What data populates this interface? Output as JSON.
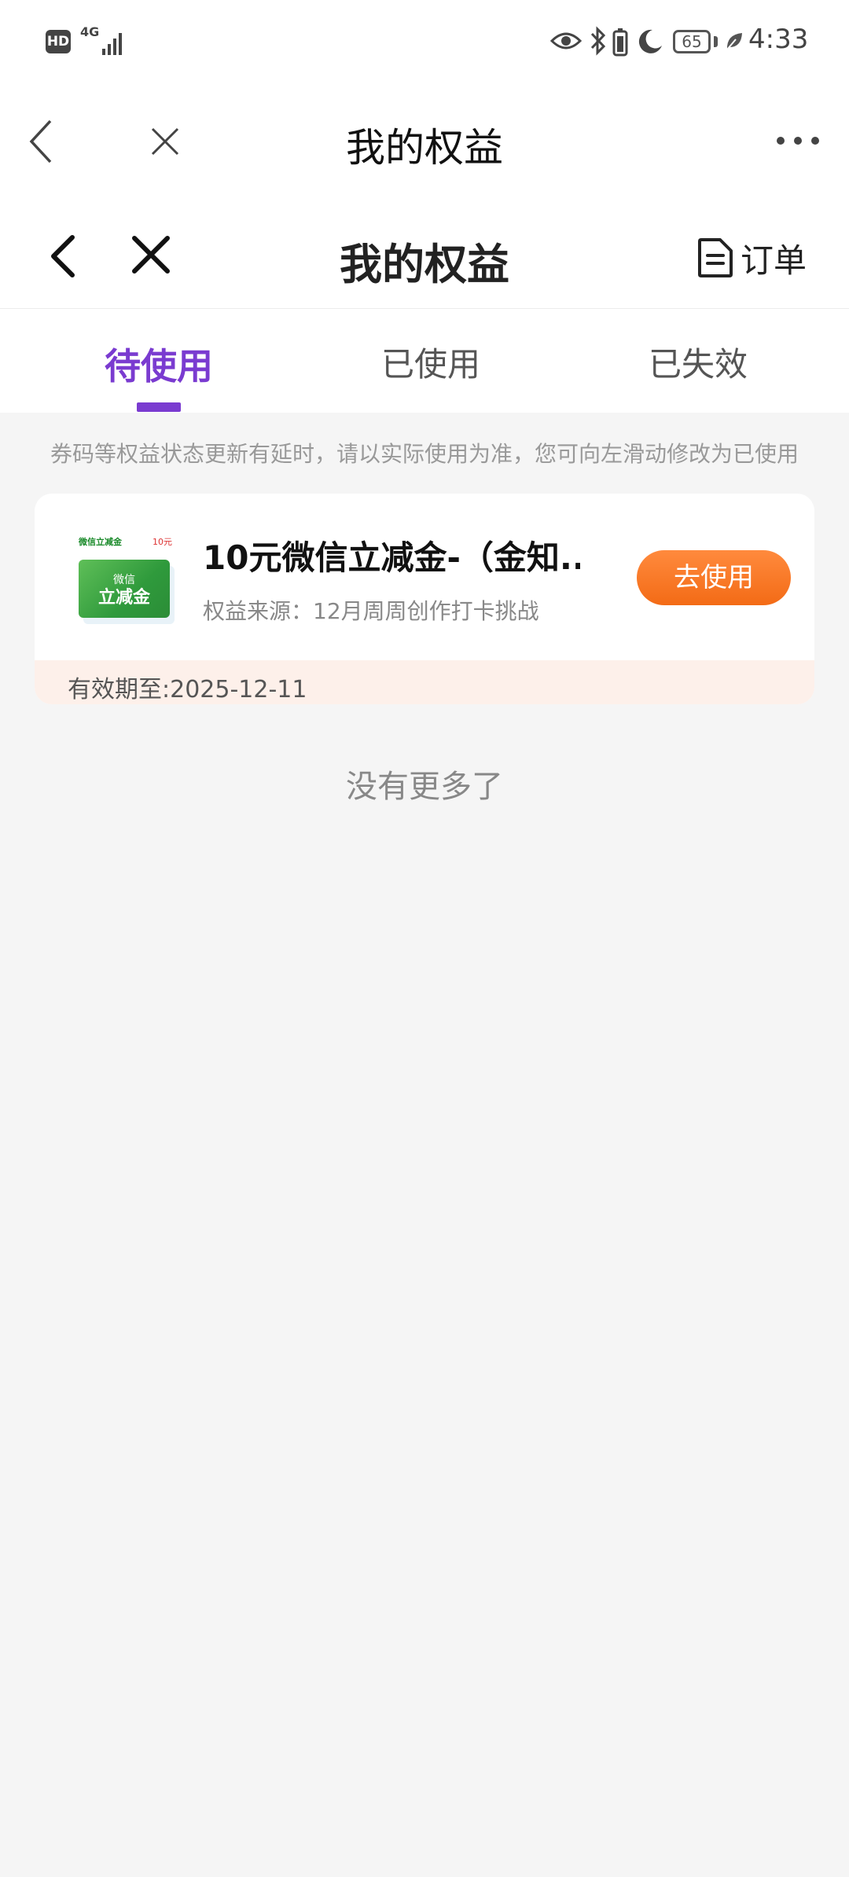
{
  "status_bar": {
    "hd": "HD",
    "network": "4G",
    "battery_level": "65",
    "time": "4:33"
  },
  "browser": {
    "title": "我的权益"
  },
  "header": {
    "title": "我的权益",
    "orders_label": "订单"
  },
  "tabs": [
    {
      "label": "待使用",
      "active": true
    },
    {
      "label": "已使用",
      "active": false
    },
    {
      "label": "已失效",
      "active": false
    }
  ],
  "notice": "券码等权益状态更新有延时，请以实际使用为准，您可向左滑动修改为已使用",
  "benefit": {
    "thumb_top_left": "微信立减金",
    "thumb_top_right": "10元",
    "thumb_small": "微信",
    "thumb_big": "立减金",
    "title": "10元微信立减金-（金知...",
    "source": "权益来源：12月周周创作打卡挑战",
    "button_label": "去使用",
    "validity": "有效期至:2025-12-11"
  },
  "no_more": "没有更多了",
  "colors": {
    "accent_purple": "#7a3bd0",
    "button_orange": "#f36b16",
    "card_footer_bg": "#fdf0ea"
  }
}
